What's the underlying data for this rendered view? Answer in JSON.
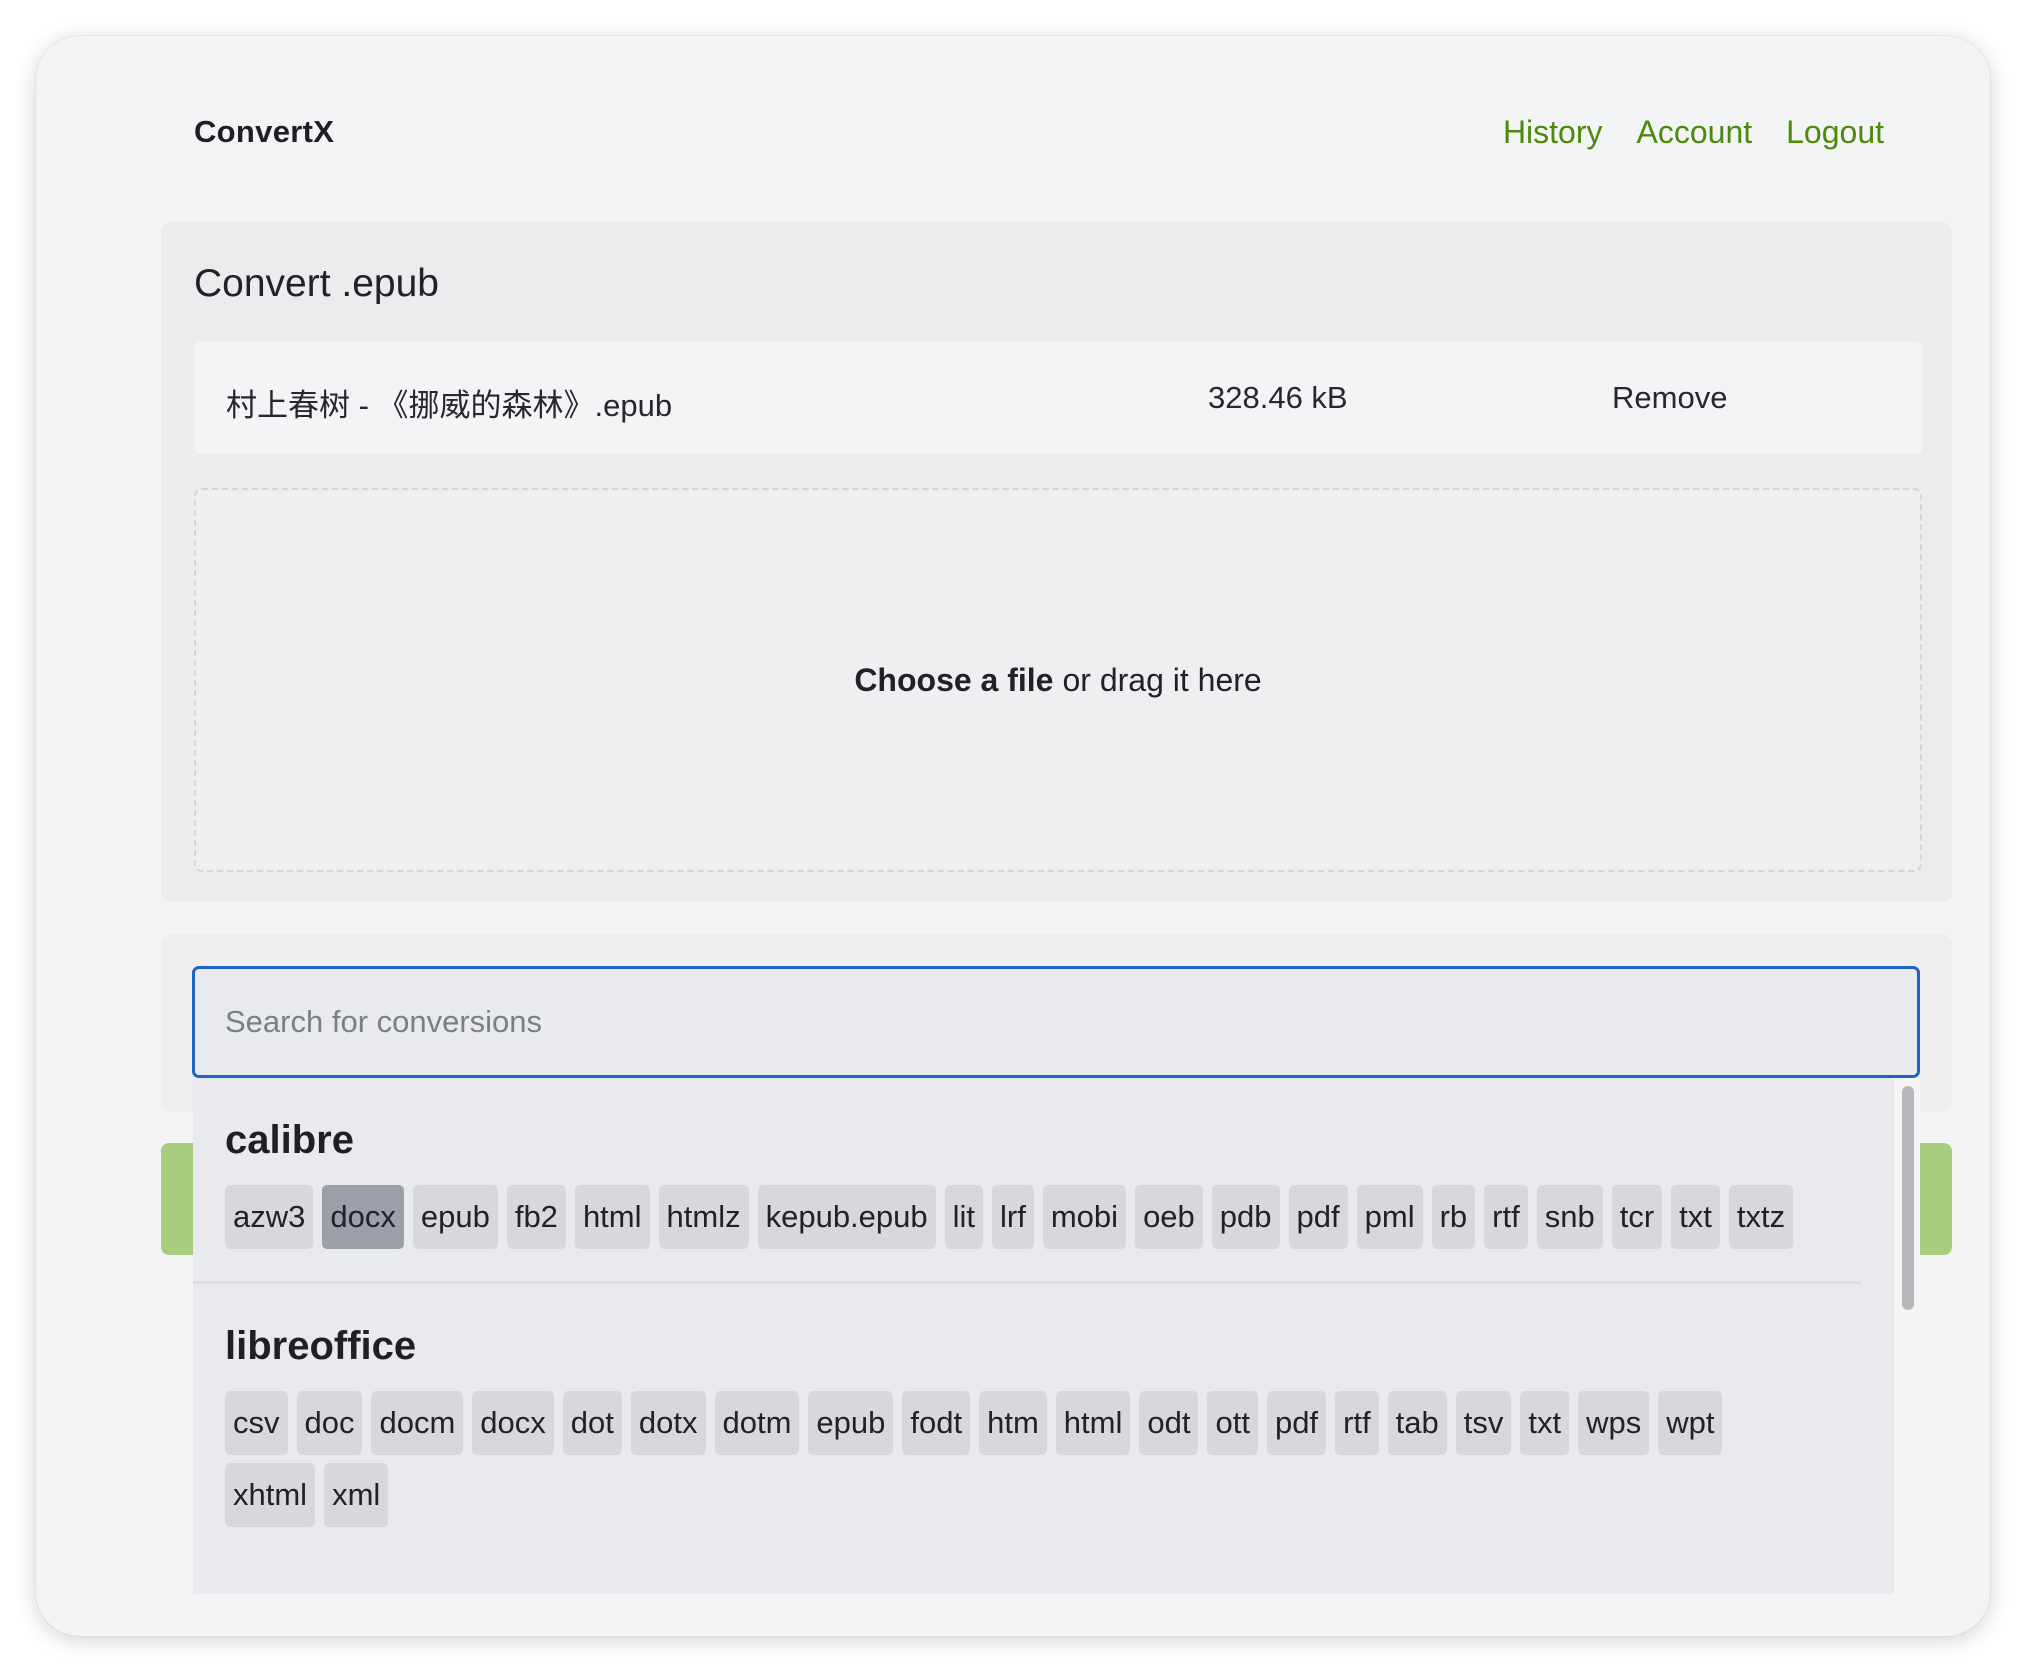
{
  "header": {
    "brand": "ConvertX",
    "nav": [
      "History",
      "Account",
      "Logout"
    ]
  },
  "upload": {
    "title": "Convert .epub",
    "file": {
      "name": "村上春树 - 《挪威的森林》.epub",
      "size": "328.46 kB",
      "remove_label": "Remove"
    },
    "dropzone": {
      "choose_label": "Choose a file",
      "drag_label": "or drag it here"
    }
  },
  "convert": {
    "search_placeholder": "Search for conversions",
    "selected": "docx",
    "groups": [
      {
        "name": "calibre",
        "formats": [
          "azw3",
          "docx",
          "epub",
          "fb2",
          "html",
          "htmlz",
          "kepub.epub",
          "lit",
          "lrf",
          "mobi",
          "oeb",
          "pdb",
          "pdf",
          "pml",
          "rb",
          "rtf",
          "snb",
          "tcr",
          "txt",
          "txtz"
        ]
      },
      {
        "name": "libreoffice",
        "formats": [
          "csv",
          "doc",
          "docm",
          "docx",
          "dot",
          "dotx",
          "dotm",
          "epub",
          "fodt",
          "htm",
          "html",
          "odt",
          "ott",
          "pdf",
          "rtf",
          "tab",
          "tsv",
          "txt",
          "wps",
          "wpt",
          "xhtml",
          "xml"
        ]
      }
    ]
  },
  "colors": {
    "accent_link": "#4d8a0a",
    "focus_border": "#1f63c4",
    "convert_button": "#a9cd7f",
    "chip_selected": "#9b9fa8"
  }
}
